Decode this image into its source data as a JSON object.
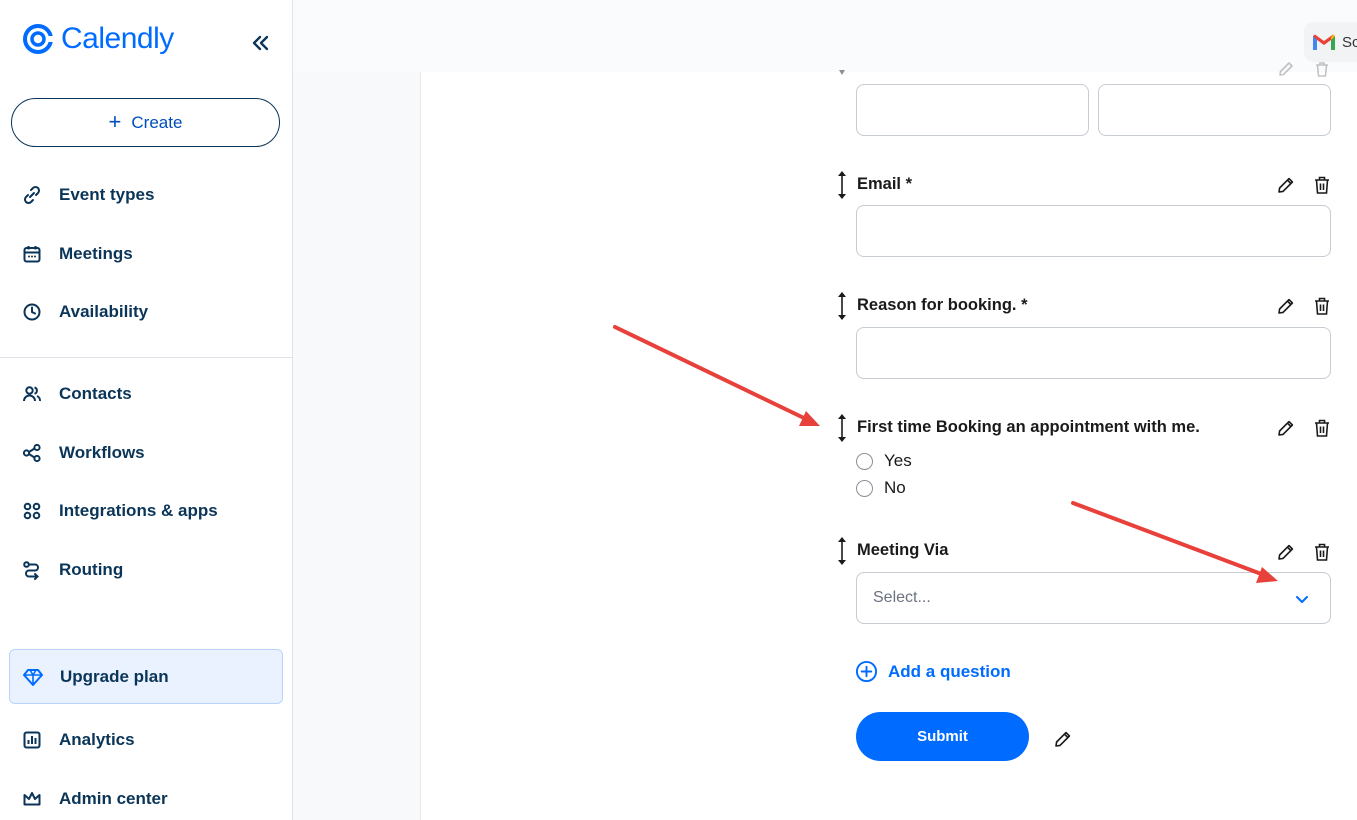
{
  "sidebar": {
    "logo_text": "Calendly",
    "collapse_label": "«",
    "create_label": "Create",
    "items": [
      {
        "label": "Event types",
        "icon": "link-icon"
      },
      {
        "label": "Meetings",
        "icon": "calendar-icon"
      },
      {
        "label": "Availability",
        "icon": "clock-icon"
      },
      {
        "label": "Contacts",
        "icon": "contacts-icon"
      },
      {
        "label": "Workflows",
        "icon": "workflow-icon"
      },
      {
        "label": "Integrations & apps",
        "icon": "apps-grid-icon"
      },
      {
        "label": "Routing",
        "icon": "routing-icon"
      }
    ],
    "upgrade_label": "Upgrade plan",
    "bottom_items": [
      {
        "label": "Analytics",
        "icon": "analytics-icon"
      },
      {
        "label": "Admin center",
        "icon": "crown-icon"
      }
    ]
  },
  "header": {
    "gmail_text": "Sc"
  },
  "form": {
    "email_label": "Email *",
    "reason_label": "Reason for booking. *",
    "first_time_label": "First time Booking an appointment with me.",
    "radio_yes": "Yes",
    "radio_no": "No",
    "meeting_via_label": "Meeting Via",
    "select_placeholder": "Select...",
    "add_question_label": "Add a question",
    "submit_label": "Submit"
  },
  "colors": {
    "brand_blue": "#006bff",
    "navy": "#0b3558",
    "annotation_arrow": "#e8403a"
  }
}
